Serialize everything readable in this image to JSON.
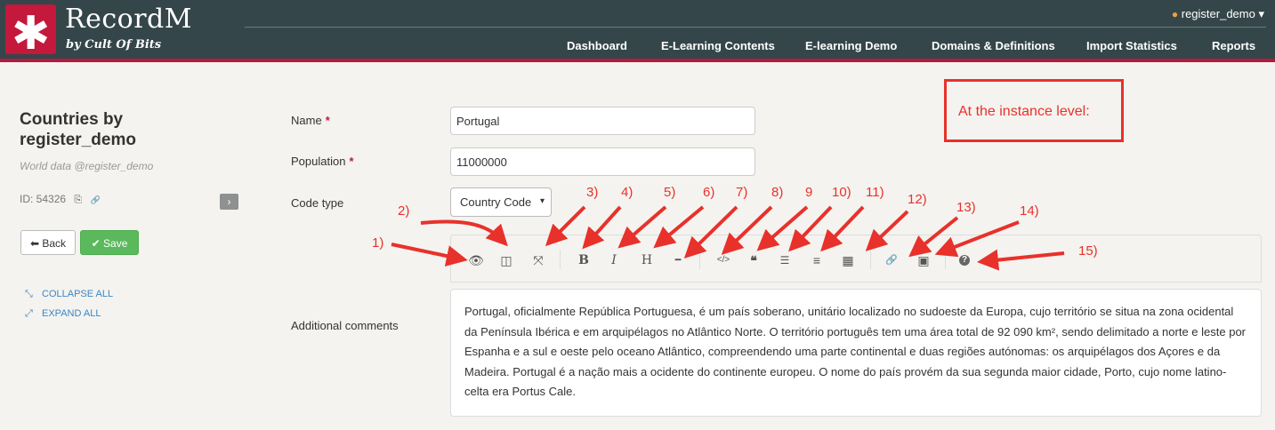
{
  "app": {
    "name": "RecordM",
    "byline": "by Cult Of Bits",
    "logo_glyph": "✱"
  },
  "user_menu": {
    "username": "register_demo",
    "person_icon": "person-icon",
    "caret": "▾"
  },
  "nav": [
    "Dashboard",
    "E-Learning Contents",
    "E-learning Demo",
    "Domains & Definitions",
    "Import Statistics",
    "Reports"
  ],
  "sidebar": {
    "title": "Countries by register_demo",
    "subtitle": "World data @register_demo",
    "id_text": "ID: 54326",
    "copy_glyph": "⎘",
    "link_glyph": "🔗",
    "toggle_glyph": "›",
    "back_label": "Back",
    "save_label": "Save",
    "back_glyph": "⬅",
    "save_glyph": "✔",
    "collapse_label": "COLLAPSE ALL",
    "expand_label": "EXPAND ALL",
    "collapse_glyph": "⤡",
    "expand_glyph": "⤢"
  },
  "form": {
    "name_label": "Name",
    "name_value": "Portugal",
    "population_label": "Population",
    "population_value": "11000000",
    "code_type_label": "Code type",
    "code_type_value": "Country Code",
    "required_mark": "*",
    "comments_label": "Additional comments",
    "comments_value": "Portugal, oficialmente República Portuguesa, é um país soberano, unitário localizado no sudoeste da Europa, cujo território se situa na zona ocidental da Península Ibérica e em arquipélagos no Atlântico Norte. O território português tem uma área total de 92 090 km², sendo delimitado a norte e leste por Espanha e a sul e oeste pelo oceano Atlântico, compreendendo uma parte continental e duas regiões autónomas: os arquipélagos dos Açores e da Madeira. Portugal é a nação mais a ocidente do continente europeu. O nome do país provém da sua segunda maior cidade, Porto, cujo nome latino-celta era Portus Cale."
  },
  "toolbar": {
    "preview": "👁",
    "side_by_side": "◫",
    "fullscreen": "⤧",
    "bold": "B",
    "italic": "I",
    "heading": "H",
    "hr": "━",
    "code": "</>",
    "quote": "❝",
    "ul": "☰",
    "ol": "≡",
    "table": "▦",
    "link": "🔗",
    "image": "▣",
    "help": "?"
  },
  "annotation": {
    "box_text": "At the instance level:",
    "numbers": [
      "1)",
      "2)",
      "3)",
      "4)",
      "5)",
      "6)",
      "7)",
      "8)",
      "9",
      "10)",
      "11)",
      "12)",
      "13)",
      "14)",
      "15)"
    ],
    "color": "#e8312b"
  },
  "colors": {
    "header_bg": "#34464a",
    "brand_red": "#c4183c",
    "save_green": "#5cb85c",
    "link_blue": "#3a87c8"
  }
}
